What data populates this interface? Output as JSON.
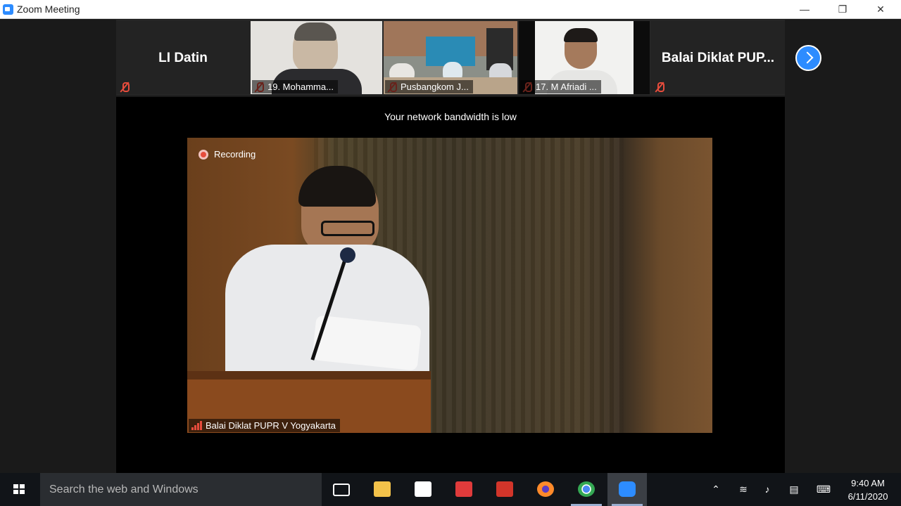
{
  "window": {
    "title": "Zoom Meeting",
    "minimize_glyph": "—",
    "restore_glyph": "❐",
    "close_glyph": "✕"
  },
  "gallery": {
    "participants": [
      {
        "display_name": "LI Datin",
        "label": "",
        "muted": true
      },
      {
        "display_name": "",
        "label": "19. Mohamma...",
        "muted": true
      },
      {
        "display_name": "",
        "label": "Pusbangkom J...",
        "muted": true
      },
      {
        "display_name": "",
        "label": "17. M Afriadi ...",
        "muted": true
      },
      {
        "display_name": "Balai Diklat PUP...",
        "label": "",
        "muted": true
      }
    ],
    "next_icon": "chevron-right-icon"
  },
  "main": {
    "bandwidth_notice": "Your network bandwidth is low",
    "recording_label": "Recording",
    "speaker_label": "Balai Diklat PUPR V Yogyakarta"
  },
  "taskbar": {
    "search_placeholder": "Search the web and Windows",
    "apps": [
      "task-view",
      "file-explorer",
      "store",
      "reader",
      "app",
      "firefox",
      "chrome",
      "zoom"
    ],
    "time": "9:40 AM",
    "date": "6/11/2020"
  },
  "colors": {
    "zoom_blue": "#2d8cff",
    "muted_red": "#e74c3c"
  }
}
